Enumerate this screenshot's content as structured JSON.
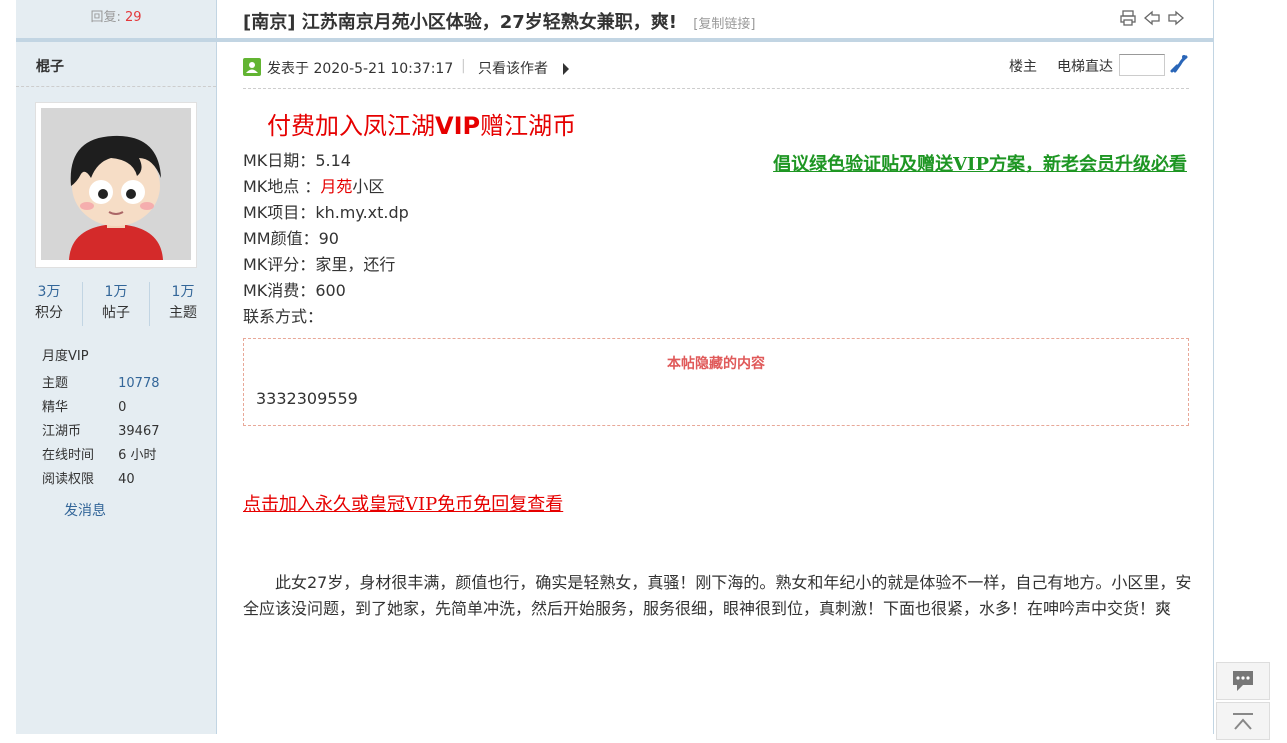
{
  "sidebar": {
    "replies_label": "回复:",
    "replies_count": "29",
    "author": "棍子",
    "stats": [
      {
        "value": "3万",
        "label": "积分"
      },
      {
        "value": "1万",
        "label": "帖子"
      },
      {
        "value": "1万",
        "label": "主题"
      }
    ],
    "group": "月度VIP",
    "info": [
      {
        "key": "主题",
        "value": "10778"
      },
      {
        "key": "精华",
        "value": "0"
      },
      {
        "key": "江湖币",
        "value": "39467"
      },
      {
        "key": "在线时间",
        "value": "6 小时"
      },
      {
        "key": "阅读权限",
        "value": "40"
      }
    ],
    "message_link": "发消息"
  },
  "thread": {
    "title": "[南京] 江苏南京月苑小区体验，27岁轻熟女兼职，爽!",
    "copy_link": "[复制链接]"
  },
  "post_header": {
    "posted_at": "发表于 2020-5-21 10:37:17",
    "separator": "|",
    "only_author": "只看该作者",
    "floor": "楼主",
    "elevator": "电梯直达"
  },
  "post": {
    "vip_join_prefix": "付费加入凤江湖",
    "vip_join_bold": "VIP",
    "vip_join_suffix": "赠江湖币",
    "initiative": "倡议绿色验证贴及赠送VIP方案，新老会员升级必看",
    "details": {
      "date_label": "MK日期：",
      "date_value": "5.14",
      "place_label": "MK地点 ：",
      "place_red": "月苑",
      "place_rest": "小区",
      "project_label": "MK项目：",
      "project_value": "kh.my.xt.dp",
      "looks_label": "MM颜值：",
      "looks_value": "90",
      "rating_label": "MK评分：",
      "rating_value": "家里，还行",
      "cost_label": "MK消费：",
      "cost_value": "600",
      "contact_label": "联系方式："
    },
    "hidden_title": "本帖隐藏的内容",
    "hidden_value": "3332309559",
    "vip_cta": "点击加入永久或皇冠VIP免币免回复查看",
    "body": "此女27岁，身材很丰满，颜值也行，确实是轻熟女，真骚！刚下海的。熟女和年纪小的就是体验不一样，自己有地方。小区里，安全应该没问题，到了她家，先简单冲洗，然后开始服务，服务很细，眼神很到位，真刺激！下面也很紧，水多！在呻吟声中交货！爽"
  }
}
